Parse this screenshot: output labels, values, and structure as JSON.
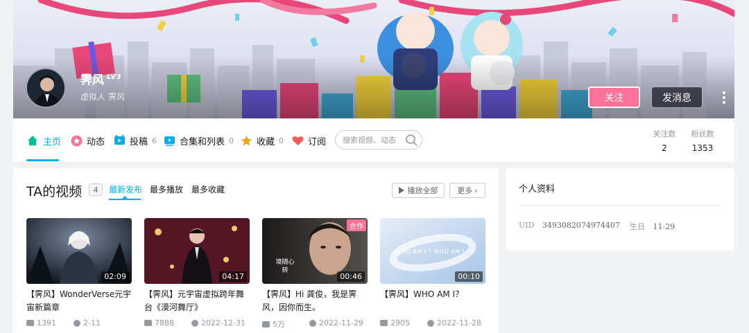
{
  "profile": {
    "name": "霁风",
    "level": "LV3",
    "sign": "虚拟人 霁风",
    "follow_label": "关注",
    "message_label": "发消息"
  },
  "nav": {
    "items": [
      {
        "label": "主页",
        "count": ""
      },
      {
        "label": "动态",
        "count": ""
      },
      {
        "label": "投稿",
        "count": "6"
      },
      {
        "label": "合集和列表",
        "count": "0"
      },
      {
        "label": "收藏",
        "count": "0"
      },
      {
        "label": "订阅",
        "count": ""
      }
    ],
    "search_placeholder": "搜索视频、动态",
    "stats": [
      {
        "label": "关注数",
        "value": "2"
      },
      {
        "label": "粉丝数",
        "value": "1353"
      }
    ]
  },
  "videos": {
    "title": "TA的视频",
    "count": "4",
    "tabs": [
      "最新发布",
      "最多播放",
      "最多收藏"
    ],
    "play_all": "播放全部",
    "more": "更多",
    "items": [
      {
        "title": "【霁风】WonderVerse元宇宙新篇章",
        "duration": "02:09",
        "plays": "1391",
        "date": "2-11",
        "badge": ""
      },
      {
        "title": "【霁风】元宇宙虚拟跨年舞台《漠河舞厅》",
        "duration": "04:17",
        "plays": "7888",
        "date": "2022-12-31",
        "badge": ""
      },
      {
        "title": "【霁风】Hi 龚俊，我是霁风，因你而生。",
        "duration": "00:46",
        "plays": "5万",
        "date": "2022-11-29",
        "badge": "合作",
        "thumb_caption": "境随心转"
      },
      {
        "title": "【霁风】WHO AM I？",
        "duration": "00:10",
        "plays": "2905",
        "date": "2022-11-28",
        "badge": "",
        "thumb_caption": "WHO AM I ? WHO AM I ?"
      }
    ]
  },
  "info": {
    "title": "个人资料",
    "uid_label": "UID",
    "uid": "3493082074974407",
    "birthday_label": "生日",
    "birthday": "11-29"
  },
  "colors": {
    "accent": "#00aeec",
    "pink": "#fb7299"
  }
}
